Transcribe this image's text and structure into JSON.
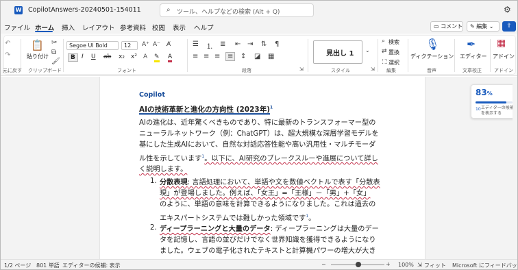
{
  "window": {
    "app_icon": "word-icon",
    "title": "CopilotAnswers-20240501-154011",
    "search_placeholder": "ツール、ヘルプなどの検索 (Alt + Q)"
  },
  "menu": {
    "items": [
      "ファイル",
      "ホーム",
      "挿入",
      "レイアウト",
      "参考資料",
      "校閲",
      "表示",
      "ヘルプ"
    ],
    "active": "ホーム",
    "comment_label": "コメント",
    "edit_label": "編集"
  },
  "ribbon": {
    "undo_group_label": "元に戻す",
    "paste_label": "貼り付け",
    "clipboard_label": "クリップボード",
    "font_name": "Segoe UI Bold",
    "font_size": "12",
    "font_group_label": "フォント",
    "paragraph_group_label": "段落",
    "style_current": "見出し 1",
    "style_group_label": "スタイル",
    "find_label": "検索",
    "replace_label": "置換",
    "select_label": "選択",
    "edit_group_label": "編集",
    "dictate_label": "ディクテーション",
    "voice_group_label": "音声",
    "editor_label": "エディター",
    "proofing_group_label": "文章校正",
    "addins_label": "アドイン",
    "addins_group_label": "アドイン"
  },
  "document": {
    "copilot_label": "Copilot",
    "heading": "AIの技術革新と進化の方向性 (2023年)",
    "heading_ref": "1",
    "para1": [
      "AIの進化は、近年驚くべきものであり、特に最新のトランスフォーマー型の",
      "ニューラルネットワーク（例：ChatGPT）は、超大規模な深層学習モデルを",
      "基にした生成AIにおいて、自然な対話応答性能や高い汎用性・マルチモーダ",
      "ル性を示しています",
      "。以下に、AI研究のブレークスルーや進展について詳し",
      "く説明します。"
    ],
    "para1_ref": "1",
    "list": [
      {
        "num": "1.",
        "lines": [
          "分散表現: 言語処理において、単語や文を数値ベクトルで表す「分散表",
          "現」が登場しました。例えば、「女王」=「王様」－「男」+「女」",
          "のように、単語の意味を計算できるようになりました。これは過去の",
          "エキスパートシステムでは難しかった領域です"
        ],
        "ref": "1"
      },
      {
        "num": "2.",
        "lines": [
          "ディープラーニングと大量のデータ: ディープラーニングは大量のデー",
          "タを記憶し、言語の並びだけでなく世界知識を獲得できるようになり",
          "ました。ウェブの電子化されたテキストと計算機パワーの増大が大き"
        ]
      }
    ]
  },
  "editor_score": {
    "percent": "83",
    "percent_suffix": "%",
    "fill": 0.83,
    "count": "10",
    "label": "エディターの候補を表示する"
  },
  "status": {
    "page": "1/2 ページ",
    "words": "801 単語",
    "editor_hint": "エディターの候補: 表示",
    "zoom": "100%",
    "fit": "フィット",
    "feedback": "Microsoft にフィードバックを"
  },
  "colors": {
    "accent": "#185abd",
    "spelling": "#c4314b"
  }
}
